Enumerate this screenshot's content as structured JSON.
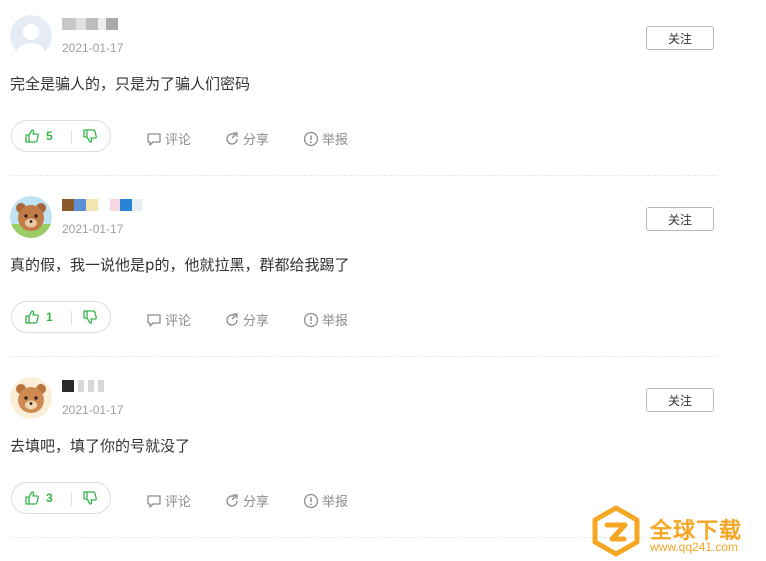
{
  "comments": [
    {
      "username": "••••",
      "date": "2021-01-17",
      "follow_label": "关注",
      "text": "完全是骗人的，只是为了骗人们密码",
      "likes": "5",
      "comment_label": "评论",
      "share_label": "分享",
      "report_label": "举报",
      "avatar": "default-avatar"
    },
    {
      "username": "••••",
      "date": "2021-01-17",
      "follow_label": "关注",
      "text": "真的假，我一说他是p的，他就拉黑，群都给我踢了",
      "likes": "1",
      "comment_label": "评论",
      "share_label": "分享",
      "report_label": "举报",
      "avatar": "bear-avatar"
    },
    {
      "username": "••••",
      "date": "2021-01-17",
      "follow_label": "关注",
      "text": "去填吧，填了你的号就没了",
      "likes": "3",
      "comment_label": "评论",
      "share_label": "分享",
      "report_label": "举报",
      "avatar": "bear-avatar"
    }
  ],
  "watermark": {
    "title": "全球下载",
    "url": "www.qq241.com"
  },
  "colors": {
    "like_green": "#37b34a",
    "muted": "#8c8c8c",
    "watermark_orange": "#f5a623"
  }
}
